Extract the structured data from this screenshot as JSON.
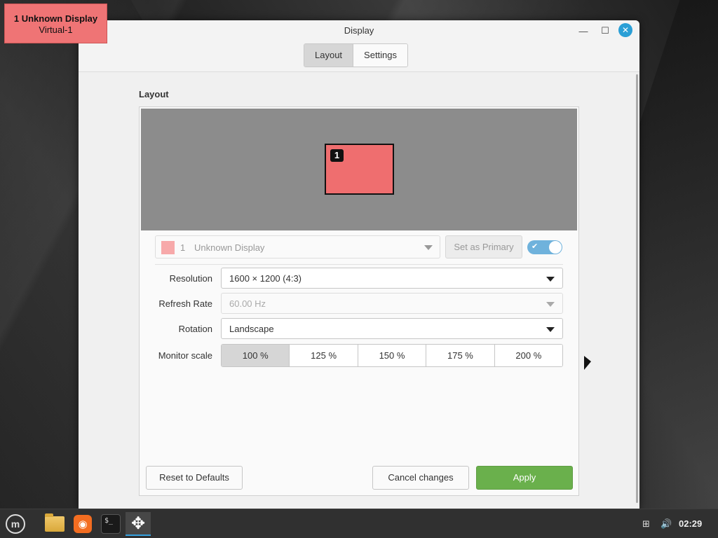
{
  "identify": {
    "line1": "1  Unknown Display",
    "line2": "Virtual-1"
  },
  "window": {
    "title": "Display",
    "controls": {
      "minimize": "—",
      "maximize": "☐",
      "close": "✕"
    },
    "tabs": [
      {
        "label": "Layout",
        "active": true
      },
      {
        "label": "Settings",
        "active": false
      }
    ]
  },
  "layout": {
    "section_title": "Layout",
    "monitor_badge": "1",
    "monitor_select": {
      "index": "1",
      "name": "Unknown Display"
    },
    "set_primary_label": "Set as Primary",
    "enabled_toggle": true,
    "rows": {
      "resolution": {
        "label": "Resolution",
        "value": "1600 × 1200 (4:3)"
      },
      "refresh_rate": {
        "label": "Refresh Rate",
        "value": "60.00 Hz"
      },
      "rotation": {
        "label": "Rotation",
        "value": "Landscape"
      },
      "monitor_scale": {
        "label": "Monitor scale",
        "options": [
          "100 %",
          "125 %",
          "150 %",
          "175 %",
          "200 %"
        ],
        "selected": "100 %"
      }
    },
    "buttons": {
      "reset": "Reset to Defaults",
      "cancel": "Cancel changes",
      "apply": "Apply"
    }
  },
  "taskbar": {
    "apps": [
      {
        "name": "menu",
        "icon": "mint-logo-icon"
      },
      {
        "name": "files",
        "icon": "folder-icon"
      },
      {
        "name": "firefox",
        "icon": "firefox-icon"
      },
      {
        "name": "terminal",
        "icon": "terminal-icon",
        "glyph": "$_"
      },
      {
        "name": "display",
        "icon": "move-arrows-icon",
        "active": true
      }
    ],
    "tray": {
      "network": "network-icon",
      "volume": "volume-icon"
    },
    "clock": "02:29"
  },
  "colors": {
    "accent": "#35a1df",
    "apply": "#6ab04c",
    "monitor": "#ef6e6f",
    "canvas": "#8c8c8c"
  }
}
